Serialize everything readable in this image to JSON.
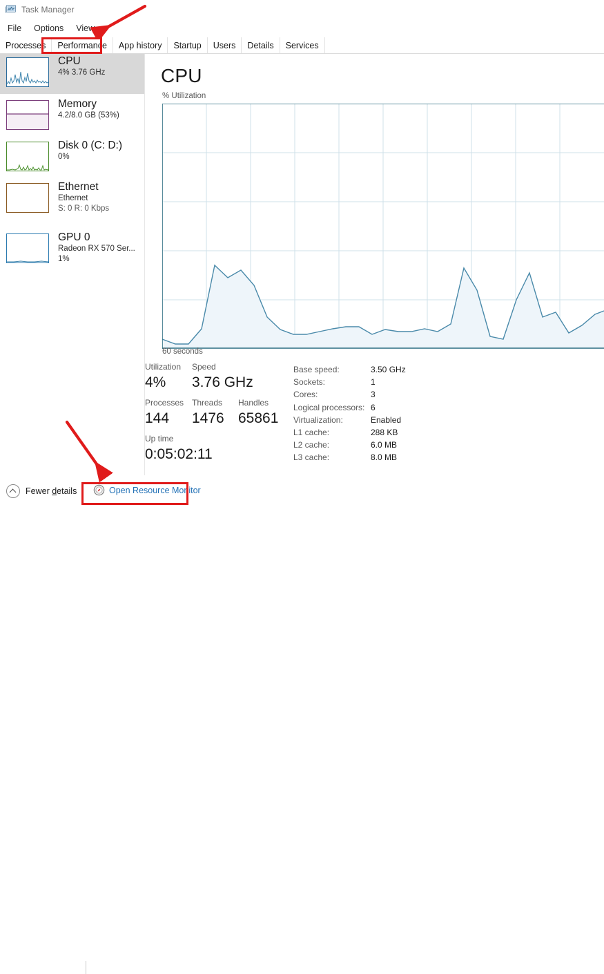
{
  "window": {
    "title": "Task Manager",
    "icon": "task-manager-icon"
  },
  "menu": {
    "items": [
      {
        "label": "File"
      },
      {
        "label": "Options"
      },
      {
        "label": "View"
      }
    ]
  },
  "tabs": {
    "active": "Performance",
    "items": [
      {
        "label": "Processes"
      },
      {
        "label": "Performance"
      },
      {
        "label": "App history"
      },
      {
        "label": "Startup"
      },
      {
        "label": "Users"
      },
      {
        "label": "Details"
      },
      {
        "label": "Services"
      }
    ]
  },
  "sidebar": {
    "items": [
      {
        "name": "CPU",
        "line2": "4%  3.76 GHz",
        "line3": "",
        "selected": true,
        "color": "#2a6b9b",
        "thumb": "cpu-sparkline"
      },
      {
        "name": "Memory",
        "line2": "4.2/8.0 GB (53%)",
        "line3": "",
        "selected": false,
        "color": "#7c3f7c",
        "thumb": "memory-fill"
      },
      {
        "name": "Disk 0 (C: D:)",
        "line2": "0%",
        "line3": "",
        "selected": false,
        "color": "#4a8b2a",
        "thumb": "disk-sparkline"
      },
      {
        "name": "Ethernet",
        "line2": "Ethernet",
        "line3": "S: 0 R: 0 Kbps",
        "selected": false,
        "color": "#8a5a22",
        "thumb": "ethernet-flat"
      },
      {
        "name": "GPU 0",
        "line2": "Radeon RX 570 Ser...",
        "line3": "1%",
        "selected": false,
        "color": "#2a7ab0",
        "thumb": "gpu-flat"
      }
    ]
  },
  "main": {
    "heading": "CPU",
    "graph_caption": "% Utilization",
    "graph_footer": "60 seconds",
    "graph_line_color": "#4a8aaa",
    "graph_fill_color": "#eef5fa",
    "grid_color": "#cfe0ea",
    "axis_color": "#2e6e82"
  },
  "stats": {
    "left": [
      [
        {
          "label": "Utilization",
          "value": "4%"
        },
        {
          "label": "Speed",
          "value": "3.76 GHz"
        }
      ],
      [
        {
          "label": "Processes",
          "value": "144"
        },
        {
          "label": "Threads",
          "value": "1476"
        },
        {
          "label": "Handles",
          "value": "65861"
        }
      ],
      [
        {
          "label": "Up time",
          "value": "0:05:02:11"
        }
      ]
    ],
    "right": [
      {
        "key": "Base speed:",
        "value": "3.50 GHz"
      },
      {
        "key": "Sockets:",
        "value": "1"
      },
      {
        "key": "Cores:",
        "value": "3"
      },
      {
        "key": "Logical processors:",
        "value": "6"
      },
      {
        "key": "Virtualization:",
        "value": "Enabled"
      },
      {
        "key": "L1 cache:",
        "value": "288 KB"
      },
      {
        "key": "L2 cache:",
        "value": "6.0 MB"
      },
      {
        "key": "L3 cache:",
        "value": "8.0 MB"
      }
    ]
  },
  "footer": {
    "fewer_details_prefix": "Fewer ",
    "fewer_details_accesskey": "d",
    "fewer_details_suffix": "etails",
    "open_resource_monitor": "Open Resource Monitor"
  },
  "annotations": {
    "color": "#e01b1b",
    "boxes": [
      {
        "target": "performance-tab"
      },
      {
        "target": "open-resource-monitor"
      }
    ],
    "arrows": [
      {
        "target": "performance-tab",
        "direction": "down-left"
      },
      {
        "target": "open-resource-monitor",
        "direction": "down-right"
      }
    ]
  },
  "chart_data": {
    "type": "area",
    "title": "CPU",
    "ylabel": "% Utilization",
    "xlabel": "60 seconds",
    "ylim": [
      0,
      100
    ],
    "xlim": [
      0,
      60
    ],
    "grid": true,
    "gridlines_x": 10,
    "gridlines_y": 5,
    "series": [
      {
        "name": "% Utilization",
        "values": [
          4,
          2,
          2,
          8,
          34,
          29,
          32,
          26,
          13,
          8,
          6,
          6,
          7,
          8,
          9,
          9,
          6,
          8,
          7,
          7,
          8,
          7,
          10,
          33,
          24,
          5,
          4,
          20,
          31,
          13,
          15,
          9,
          12,
          14
        ]
      }
    ]
  }
}
